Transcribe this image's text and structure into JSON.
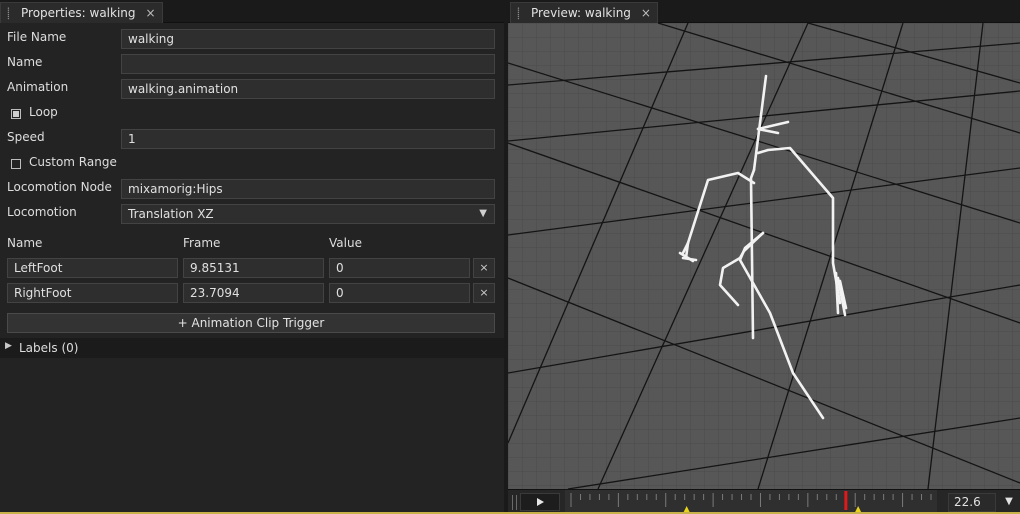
{
  "properties_tab": {
    "title": "Properties: walking",
    "close": "×"
  },
  "fields": {
    "file_name": {
      "label": "File Name",
      "value": "walking"
    },
    "name": {
      "label": "Name",
      "value": ""
    },
    "animation": {
      "label": "Animation",
      "value": "walking.animation"
    },
    "loop": {
      "label": "Loop",
      "checked": true
    },
    "speed": {
      "label": "Speed",
      "value": "1"
    },
    "custom_range": {
      "label": "Custom Range",
      "checked": false
    },
    "locomotion_node": {
      "label": "Locomotion Node",
      "value": "mixamorig:Hips"
    },
    "locomotion": {
      "label": "Locomotion",
      "value": "Translation XZ"
    }
  },
  "triggers": {
    "columns": [
      "Name",
      "Frame",
      "Value"
    ],
    "rows": [
      {
        "name": "LeftFoot",
        "frame": "9.85131",
        "value": "0",
        "remove": "×"
      },
      {
        "name": "RightFoot",
        "frame": "23.7094",
        "value": "0",
        "remove": "×"
      }
    ],
    "add_label": "+ Animation Clip Trigger"
  },
  "labels_section": {
    "label": "Labels (0)"
  },
  "preview_tab": {
    "title": "Preview: walking",
    "close": "×"
  },
  "timeline": {
    "current_time": "22.6",
    "playhead_fraction": 0.755,
    "trigger_marker_fractions": [
      0.327,
      0.788
    ],
    "colors": {
      "playhead": "#e01a1a",
      "marker": "#e8d21a"
    }
  },
  "icons": {
    "pin": "pin-icon",
    "play": "play-icon",
    "dropdown": "chevron-down-icon",
    "expand": "triangle-right-icon"
  }
}
